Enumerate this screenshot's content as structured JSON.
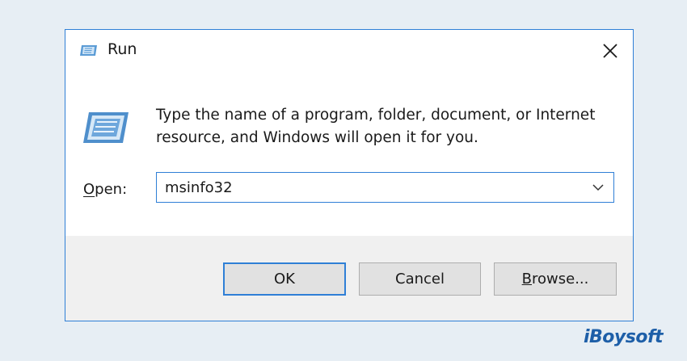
{
  "window": {
    "title": "Run",
    "close_icon": "close-icon",
    "title_icon": "run-icon"
  },
  "body": {
    "icon": "run-icon",
    "description": "Type the name of a program, folder, document, or Internet resource, and Windows will open it for you."
  },
  "open_field": {
    "label_accel": "O",
    "label_rest": "pen:",
    "value": "msinfo32",
    "dropdown_icon": "chevron-down-icon"
  },
  "buttons": {
    "ok": "OK",
    "cancel": "Cancel",
    "browse_accel": "B",
    "browse_rest": "rowse..."
  },
  "watermark": "iBoysoft",
  "colors": {
    "accent": "#2f7fd6",
    "footer": "#f0f0f0",
    "page_bg": "#e7eef4",
    "brand": "#1e5fa8"
  }
}
